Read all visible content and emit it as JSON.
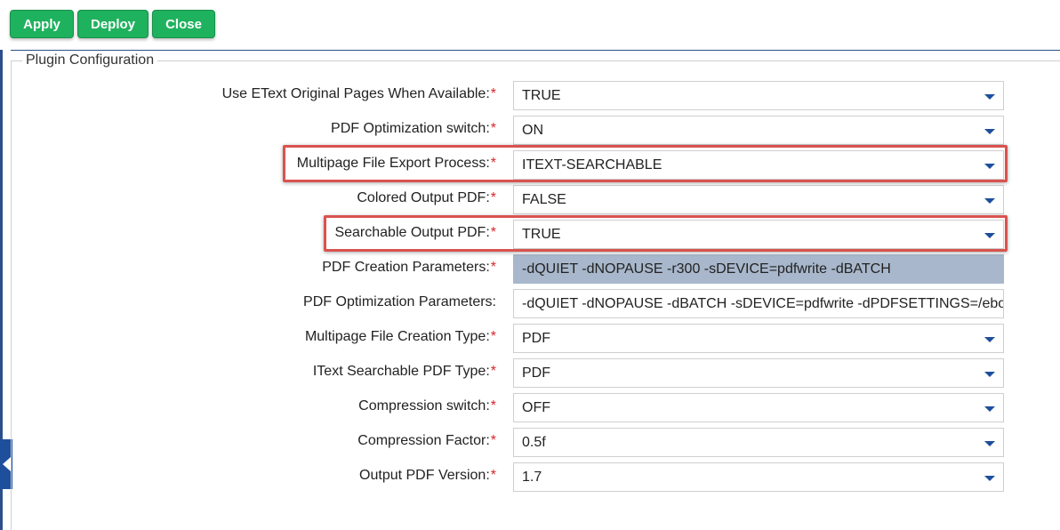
{
  "toolbar": {
    "apply_label": "Apply",
    "deploy_label": "Deploy",
    "close_label": "Close"
  },
  "section": {
    "legend": "Plugin Configuration"
  },
  "required_marker": "*",
  "fields": [
    {
      "label": "Use EText Original Pages When Available:",
      "required": true,
      "value": "TRUE",
      "type": "select"
    },
    {
      "label": "PDF Optimization switch:",
      "required": true,
      "value": "ON",
      "type": "select"
    },
    {
      "label": "Multipage File Export Process:",
      "required": true,
      "value": "ITEXT-SEARCHABLE",
      "type": "select"
    },
    {
      "label": "Colored Output PDF:",
      "required": true,
      "value": "FALSE",
      "type": "select"
    },
    {
      "label": "Searchable Output PDF:",
      "required": true,
      "value": "TRUE",
      "type": "select"
    },
    {
      "label": "PDF Creation Parameters:",
      "required": true,
      "value": "-dQUIET -dNOPAUSE -r300 -sDEVICE=pdfwrite -dBATCH",
      "type": "text-readonly"
    },
    {
      "label": "PDF Optimization Parameters:",
      "required": false,
      "value": "-dQUIET -dNOPAUSE -dBATCH -sDEVICE=pdfwrite -dPDFSETTINGS=/eboo",
      "type": "text"
    },
    {
      "label": "Multipage File Creation Type:",
      "required": true,
      "value": "PDF",
      "type": "select"
    },
    {
      "label": "IText Searchable PDF Type:",
      "required": true,
      "value": "PDF",
      "type": "select"
    },
    {
      "label": "Compression switch:",
      "required": true,
      "value": "OFF",
      "type": "select"
    },
    {
      "label": "Compression Factor:",
      "required": true,
      "value": "0.5f",
      "type": "select"
    },
    {
      "label": "Output PDF Version:",
      "required": true,
      "value": "1.7",
      "type": "select"
    }
  ],
  "colors": {
    "button_green": "#1fb25e",
    "accent_blue": "#1e4f9c",
    "required_red": "#d8242b",
    "highlight_red": "#d9534f",
    "readonly_field": "#a8b7cb"
  },
  "icons": {
    "dropdown": "chevron-down-icon",
    "collapse": "caret-left-icon"
  }
}
